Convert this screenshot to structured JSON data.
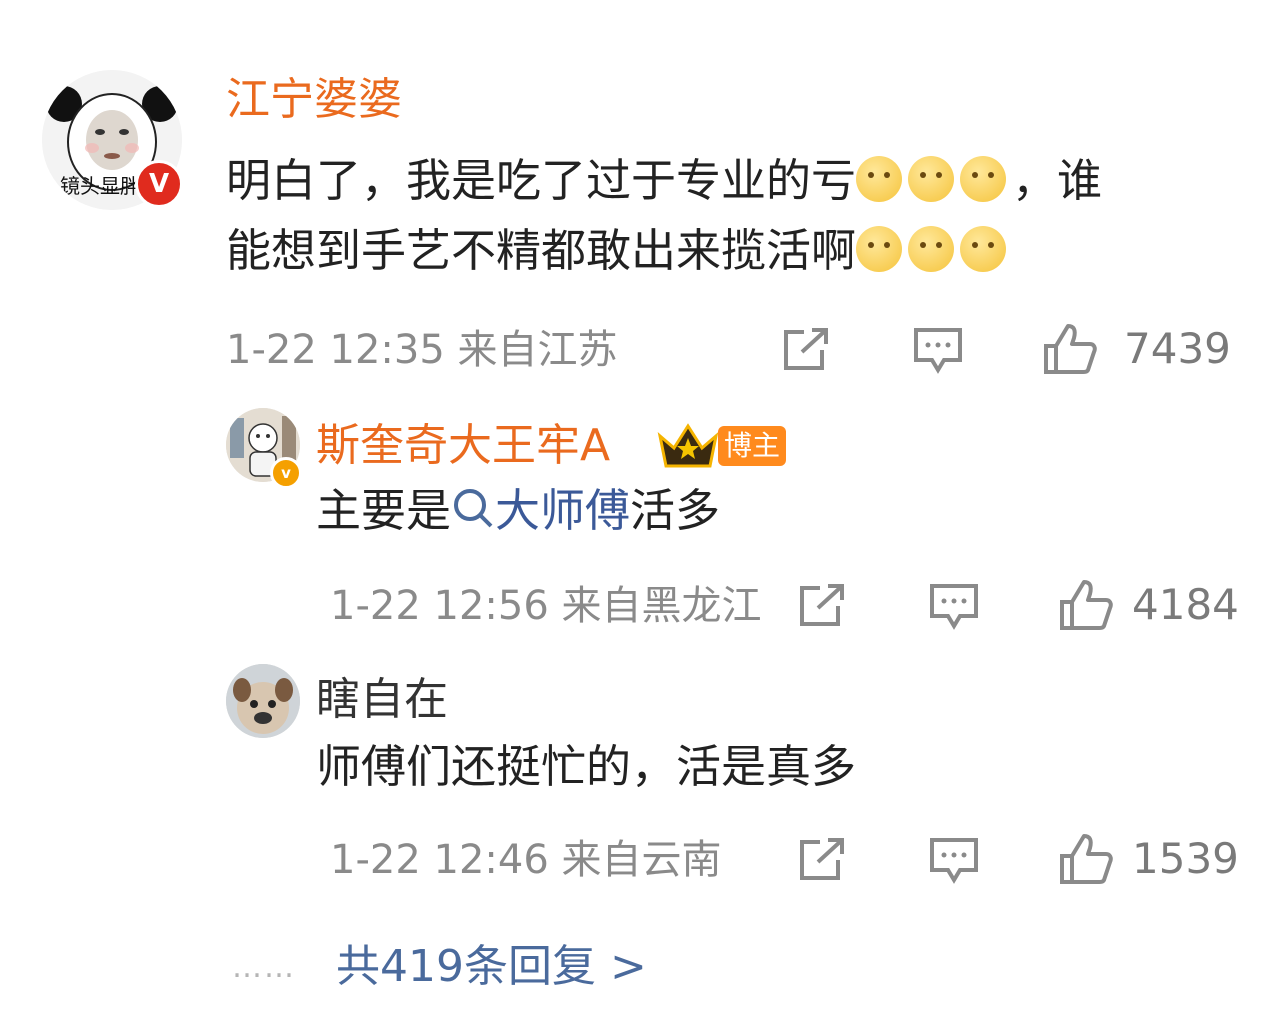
{
  "main_comment": {
    "avatar_icon": "panda-meme-avatar",
    "avatar_caption": "镜头显胖",
    "verified_mark": "V",
    "username": "江宁婆婆",
    "text_line1_a": "明白了，我是吃了过于专业的亏",
    "text_line1_b": "，谁",
    "text_line2": "能想到手艺不精都敢出来揽活啊",
    "emoji_name": "thinking-emoji",
    "timestamp": "1-22 12:35 来自江苏",
    "like_count": "7439"
  },
  "replies": [
    {
      "avatar_icon": "illustrated-avatar",
      "verified_mark": "v",
      "username": "斯奎奇大王牢A",
      "crown_icon": "crown-icon",
      "badge": "博主",
      "text_prefix": "主要是",
      "topic": "大师傅",
      "text_suffix": "活多",
      "timestamp": "1-22 12:56 来自黑龙江",
      "like_count": "4184"
    },
    {
      "avatar_icon": "dog-photo-avatar",
      "username": "瞎自在",
      "text": "师傅们还挺忙的，活是真多",
      "timestamp": "1-22 12:46 来自云南",
      "like_count": "1539"
    }
  ],
  "more": {
    "dots": "……",
    "label": "共419条回复 >"
  },
  "colors": {
    "username_orange": "#ea6a1e",
    "link_blue": "#4a6a9c",
    "meta_gray": "#8a8a8a"
  }
}
